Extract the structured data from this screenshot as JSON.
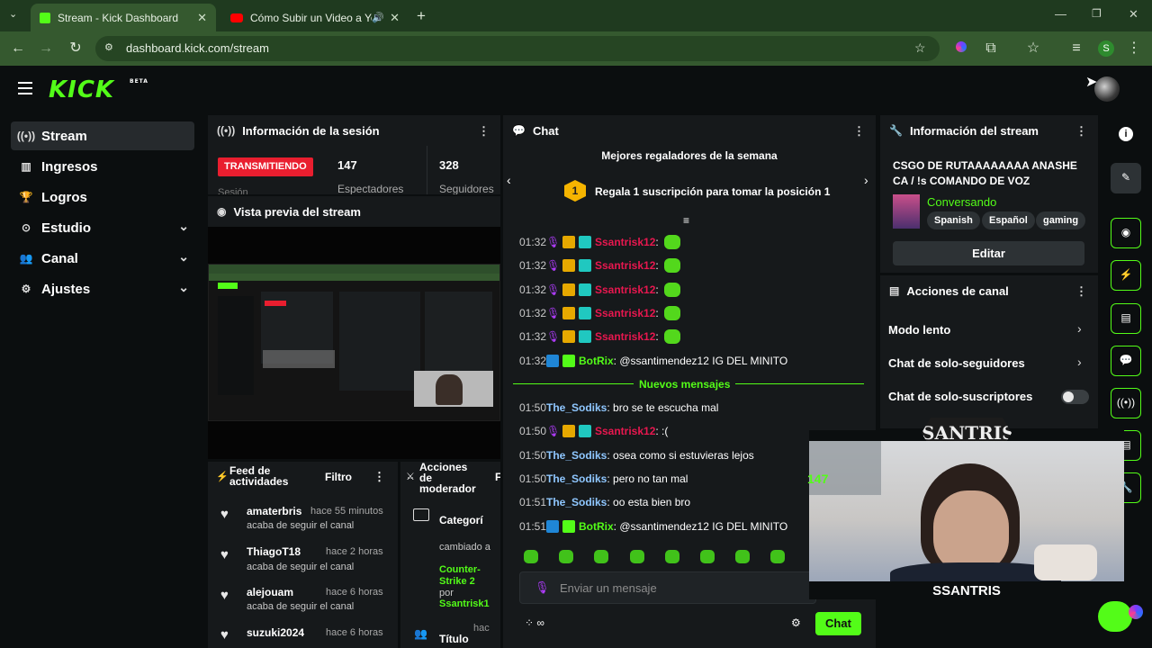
{
  "browser": {
    "tabs": [
      {
        "title": "Stream - Kick Dashboard",
        "active": true
      },
      {
        "title": "Cómo Subir un Video a You",
        "active": false
      }
    ],
    "url": "dashboard.kick.com/stream",
    "profile_initial": "S"
  },
  "sidebar": {
    "items": [
      {
        "label": "Stream",
        "icon": "broadcast-icon",
        "active": true
      },
      {
        "label": "Ingresos",
        "icon": "bar-chart-icon"
      },
      {
        "label": "Logros",
        "icon": "trophy-icon"
      },
      {
        "label": "Estudio",
        "icon": "studio-icon",
        "expandable": true
      },
      {
        "label": "Canal",
        "icon": "users-icon",
        "expandable": true
      },
      {
        "label": "Ajustes",
        "icon": "gear-icon",
        "expandable": true
      }
    ]
  },
  "logo": {
    "text": "KICK",
    "badge": "BETA"
  },
  "session": {
    "title": "Información de la sesión",
    "status": "TRANSMITIENDO",
    "viewers": "147",
    "viewers_label": "Espectadores",
    "followers": "328",
    "followers_label": "Seguidores",
    "cut_label": "Sesión"
  },
  "preview": {
    "title": "Vista previa del stream"
  },
  "feed": {
    "title": "Feed de actividades",
    "filter": "Filtro",
    "items": [
      {
        "name": "amaterbris",
        "time": "hace 55 minutos",
        "text": "acaba de seguir el canal"
      },
      {
        "name": "ThiagoT18",
        "time": "hace 2 horas",
        "text": "acaba de seguir el canal"
      },
      {
        "name": "alejouam",
        "time": "hace 6 horas",
        "text": "acaba de seguir el canal"
      },
      {
        "name": "suzuki2024",
        "time": "hace 6 horas",
        "text": ""
      }
    ]
  },
  "mod": {
    "title": "Acciones de moderador",
    "item_title": "Categorí",
    "text1": "cambiado a",
    "category": "Counter-Strike 2",
    "text2": "por",
    "user": "Ssantrisk1",
    "time": "hac",
    "cut_title": "Título",
    "extra": "F"
  },
  "chat": {
    "title": "Chat",
    "gifters_title": "Mejores regaladores de la semana",
    "gift_rank": "1",
    "gift_text": "Regala 1 suscripción para tomar la posición 1",
    "new_messages": "Nuevos mensajes",
    "input_placeholder": "Enviar un mensaje",
    "send_label": "Chat",
    "messages_before": [
      {
        "time": "01:32",
        "user": "Ssantrisk12",
        "color": "#e8174f",
        "text": ":",
        "emote": true
      },
      {
        "time": "01:32",
        "user": "Ssantrisk12",
        "color": "#e8174f",
        "text": ":",
        "emote": true
      },
      {
        "time": "01:32",
        "user": "Ssantrisk12",
        "color": "#e8174f",
        "text": ":",
        "emote": true
      },
      {
        "time": "01:32",
        "user": "Ssantrisk12",
        "color": "#e8174f",
        "text": ":",
        "emote": true
      },
      {
        "time": "01:32",
        "user": "Ssantrisk12",
        "color": "#e8174f",
        "text": ":",
        "emote": true
      },
      {
        "time": "01:32",
        "user": "BotRix",
        "color": "#53fc18",
        "text": ": @ssantimendez12 IG DEL MINITO",
        "bot": true
      }
    ],
    "messages_after": [
      {
        "time": "01:50",
        "user": "The_Sodiks",
        "color": "#8fc7ff",
        "text": ": bro se te escucha mal"
      },
      {
        "time": "01:50",
        "user": "Ssantrisk12",
        "color": "#e8174f",
        "text": ": :(",
        "sub": true
      },
      {
        "time": "01:50",
        "user": "The_Sodiks",
        "color": "#8fc7ff",
        "text": ": osea como si estuvieras lejos"
      },
      {
        "time": "01:50",
        "user": "The_Sodiks",
        "color": "#8fc7ff",
        "text": ": pero no tan mal"
      },
      {
        "time": "01:51",
        "user": "The_Sodiks",
        "color": "#8fc7ff",
        "text": ": oo esta bien bro"
      },
      {
        "time": "01:51",
        "user": "BotRix",
        "color": "#53fc18",
        "text": ": @ssantimendez12 IG DEL MINITO",
        "bot": true
      }
    ]
  },
  "stream_info": {
    "title": "Información del stream",
    "stream_title": "CSGO DE RUTAAAAAAAA ANASHE CA / !s COMANDO DE VOZ",
    "category": "Conversando",
    "tags": [
      "Spanish",
      "Español",
      "gaming"
    ],
    "edit_label": "Editar"
  },
  "channel_actions": {
    "title": "Acciones de canal",
    "items": [
      {
        "label": "Modo lento",
        "control": "chevron"
      },
      {
        "label": "Chat de solo-seguidores",
        "control": "chevron"
      },
      {
        "label": "Chat de solo-suscriptores",
        "control": "toggle"
      }
    ]
  },
  "overlay": {
    "brand_top": "SANTRIS",
    "brand_bottom": "SSANTRIS",
    "viewer_count": "147"
  },
  "colors": {
    "accent": "#53fc18",
    "live": "#e91e2f",
    "panel": "#16191b",
    "background": "#0b0e0f"
  }
}
